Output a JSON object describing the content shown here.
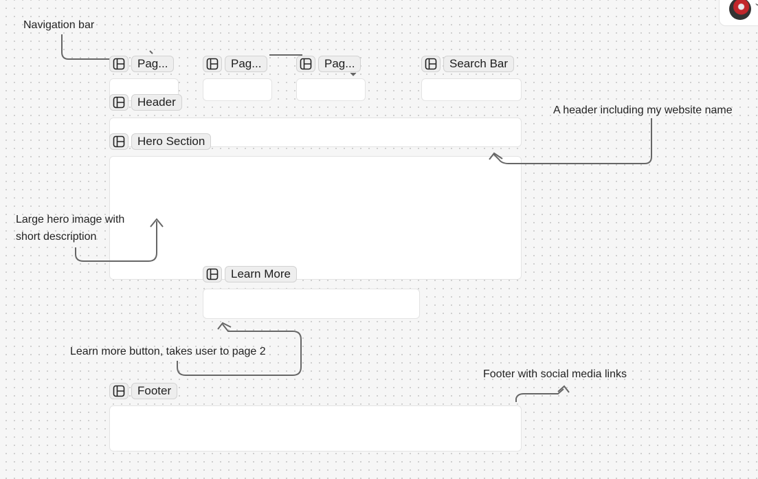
{
  "notes": {
    "navigation": "Navigation bar",
    "header": "A header including my website name",
    "hero_line1": "Large hero image with",
    "hero_line2": "short description",
    "learn_more": "Learn more button, takes user to page 2",
    "footer": "Footer with social media links"
  },
  "components": {
    "page1": "Pag...",
    "page2": "Pag...",
    "page3": "Pag...",
    "search": "Search Bar",
    "header": "Header",
    "hero": "Hero Section",
    "learn_more": "Learn More",
    "footer": "Footer"
  },
  "icons": {
    "component": "layout-panel-icon",
    "user": "avatar",
    "menu": "chevron-down-icon"
  },
  "colors": {
    "canvas": "#f6f6f6",
    "box": "#ffffff",
    "tag_background": "#eeeeee",
    "connector": "#666666"
  }
}
